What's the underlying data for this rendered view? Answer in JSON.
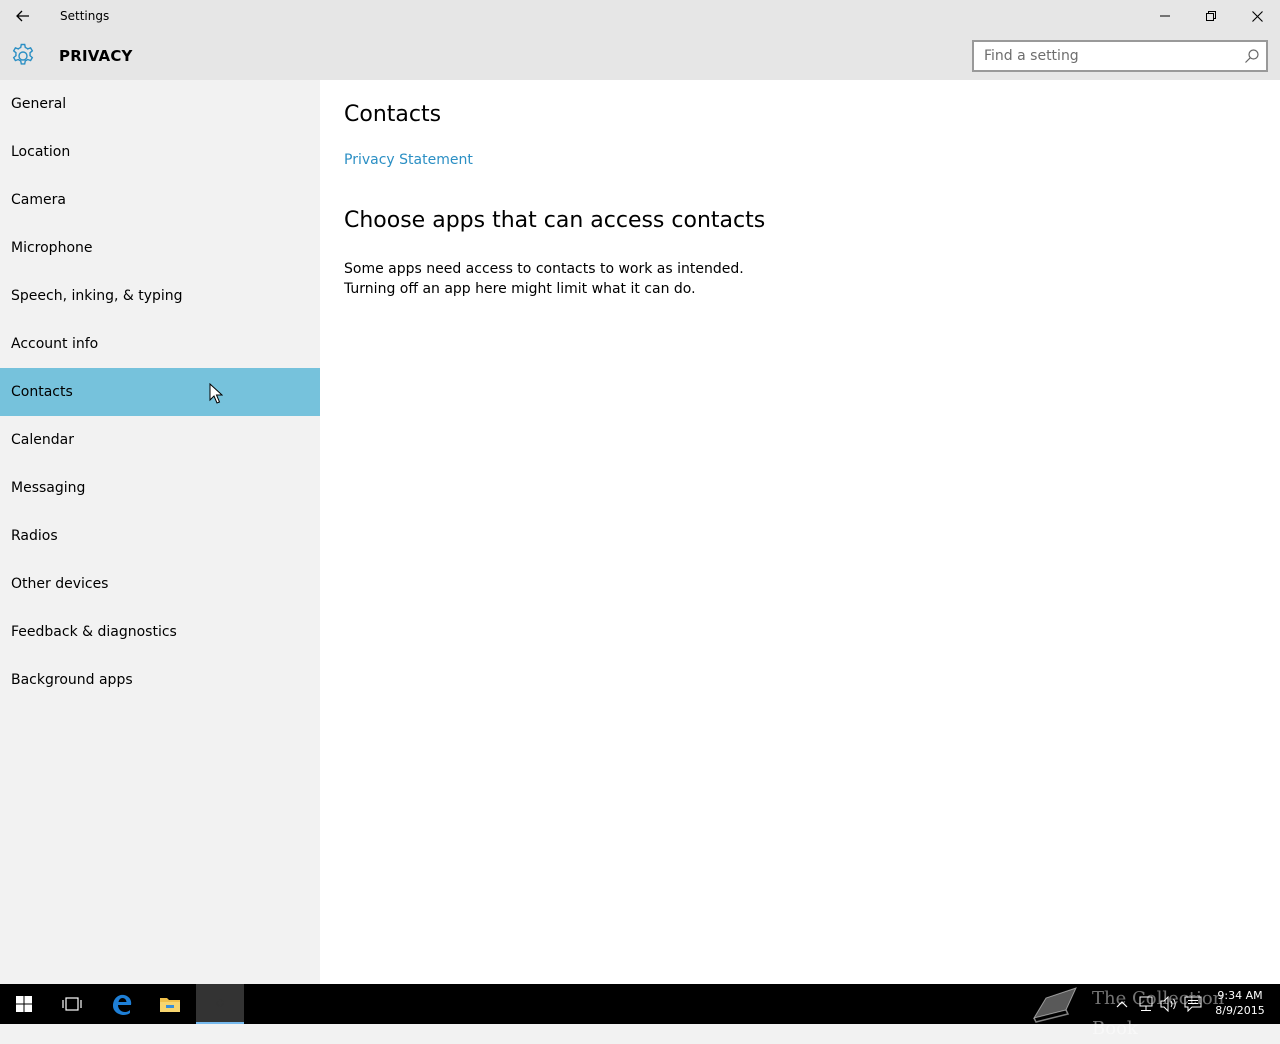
{
  "titlebar": {
    "title": "Settings"
  },
  "header": {
    "section_title": "PRIVACY",
    "search_placeholder": "Find a setting"
  },
  "sidebar": {
    "items": [
      {
        "label": "General",
        "selected": false
      },
      {
        "label": "Location",
        "selected": false
      },
      {
        "label": "Camera",
        "selected": false
      },
      {
        "label": "Microphone",
        "selected": false
      },
      {
        "label": "Speech, inking, & typing",
        "selected": false
      },
      {
        "label": "Account info",
        "selected": false
      },
      {
        "label": "Contacts",
        "selected": true
      },
      {
        "label": "Calendar",
        "selected": false
      },
      {
        "label": "Messaging",
        "selected": false
      },
      {
        "label": "Radios",
        "selected": false
      },
      {
        "label": "Other devices",
        "selected": false
      },
      {
        "label": "Feedback & diagnostics",
        "selected": false
      },
      {
        "label": "Background apps",
        "selected": false
      }
    ]
  },
  "main": {
    "title": "Contacts",
    "privacy_link": "Privacy Statement",
    "heading": "Choose apps that can access contacts",
    "description": "Some apps need access to contacts to work as intended. Turning off an app here might limit what it can do."
  },
  "taskbar": {
    "time": "9:34 AM",
    "date": "8/9/2015",
    "watermark": "The Collection Book"
  },
  "colors": {
    "accent": "#76c2dc",
    "link": "#2b8fc4",
    "titlebar": "#e6e6e6",
    "sidebar": "#f2f2f2",
    "taskbar": "#000000"
  }
}
